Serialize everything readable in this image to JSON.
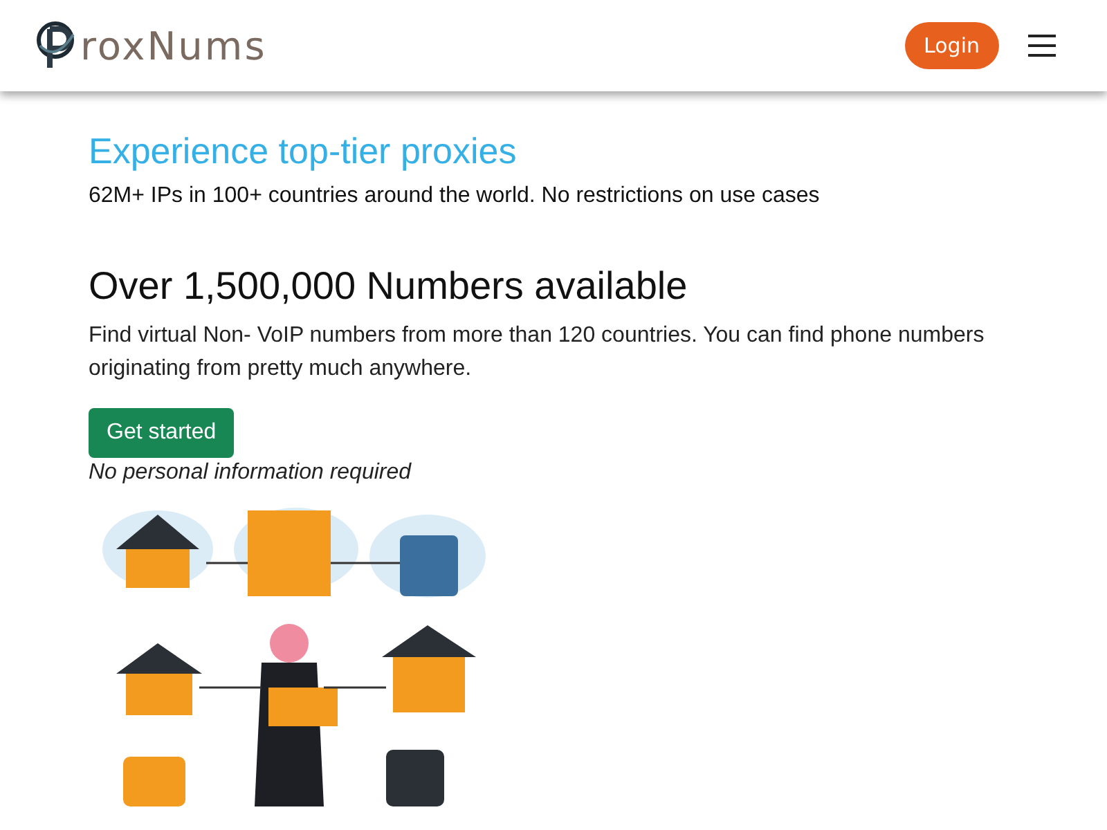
{
  "navbar": {
    "brand": "roxNums",
    "login_button": "Login"
  },
  "hero": {
    "heading": "Experience top-tier proxies",
    "subtext": "62M+ IPs in 100+ countries around the world. No restrictions on use cases"
  },
  "numbers": {
    "heading": "Over 1,500,000 Numbers available",
    "description": "Find virtual Non- VoIP numbers from more than 120 countries. You can find phone numbers originating from pretty much anywhere.",
    "cta_button": "Get started",
    "note": "No personal information required"
  }
}
